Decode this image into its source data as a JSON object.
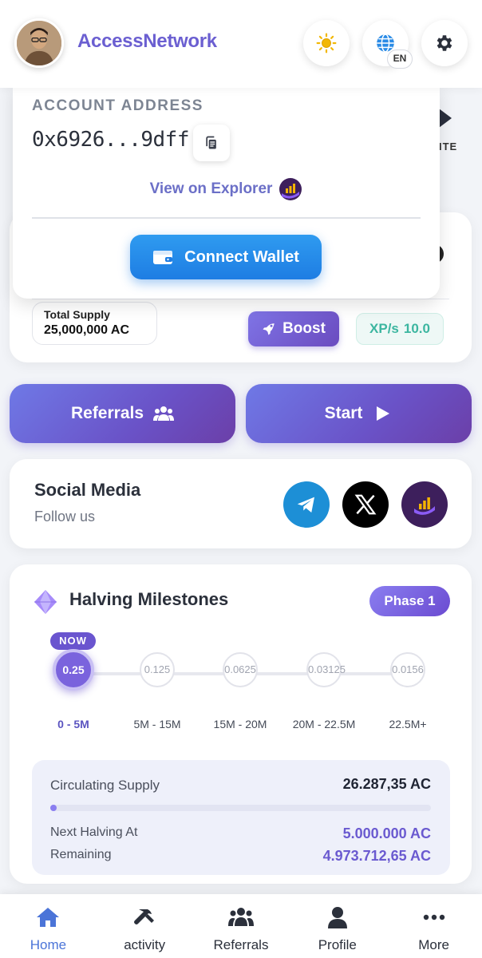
{
  "header": {
    "app_title": "AccessNetwork",
    "lang": "EN",
    "theme_icon": "sun-icon",
    "language_icon": "globe-icon",
    "settings_icon": "gear-icon"
  },
  "account_popover": {
    "label": "ACCOUNT ADDRESS",
    "address": "0x6926...9dff",
    "explorer_link": "View on Explorer",
    "connect_wallet": "Connect Wallet"
  },
  "behind": {
    "invite_label_fragment": "ITE"
  },
  "stats": {
    "total_supply_label": "Total Supply",
    "total_supply_value": "25,000,000 AC",
    "boost_label": "Boost",
    "xp_label": "XP/s",
    "xp_value": "10.0"
  },
  "actions": {
    "referrals": "Referrals",
    "start": "Start"
  },
  "social": {
    "title": "Social Media",
    "subtitle": "Follow us",
    "icons": [
      "telegram-icon",
      "x-icon",
      "access-network-icon"
    ]
  },
  "halving": {
    "title": "Halving Milestones",
    "phase": "Phase 1",
    "now_label": "NOW",
    "milestones": [
      {
        "rate": "0.25",
        "range": "0 - 5M",
        "active": true
      },
      {
        "rate": "0.125",
        "range": "5M - 15M",
        "active": false
      },
      {
        "rate": "0.0625",
        "range": "15M - 20M",
        "active": false
      },
      {
        "rate": "0.03125",
        "range": "20M - 22.5M",
        "active": false
      },
      {
        "rate": "0.0156",
        "range": "22.5M+",
        "active": false
      }
    ],
    "circulating_label": "Circulating Supply",
    "circulating_value": "26.287,35 AC",
    "progress_fraction": 0.005,
    "next_halving_label": "Next Halving At",
    "next_halving_value": "5.000.000 AC",
    "remaining_label": "Remaining",
    "remaining_value": "4.973.712,65 AC"
  },
  "nav": {
    "items": [
      {
        "label": "Home",
        "icon": "home-icon",
        "active": true
      },
      {
        "label": "activity",
        "icon": "hammer-icon",
        "active": false
      },
      {
        "label": "Referrals",
        "icon": "users-icon",
        "active": false
      },
      {
        "label": "Profile",
        "icon": "user-icon",
        "active": false
      },
      {
        "label": "More",
        "icon": "more-dots-icon",
        "active": false
      }
    ]
  },
  "colors": {
    "brand_purple": "#6b5fd1",
    "connect_blue": "#1e7de3",
    "xp_green": "#3cb6a0",
    "nav_active": "#4b74d8"
  }
}
